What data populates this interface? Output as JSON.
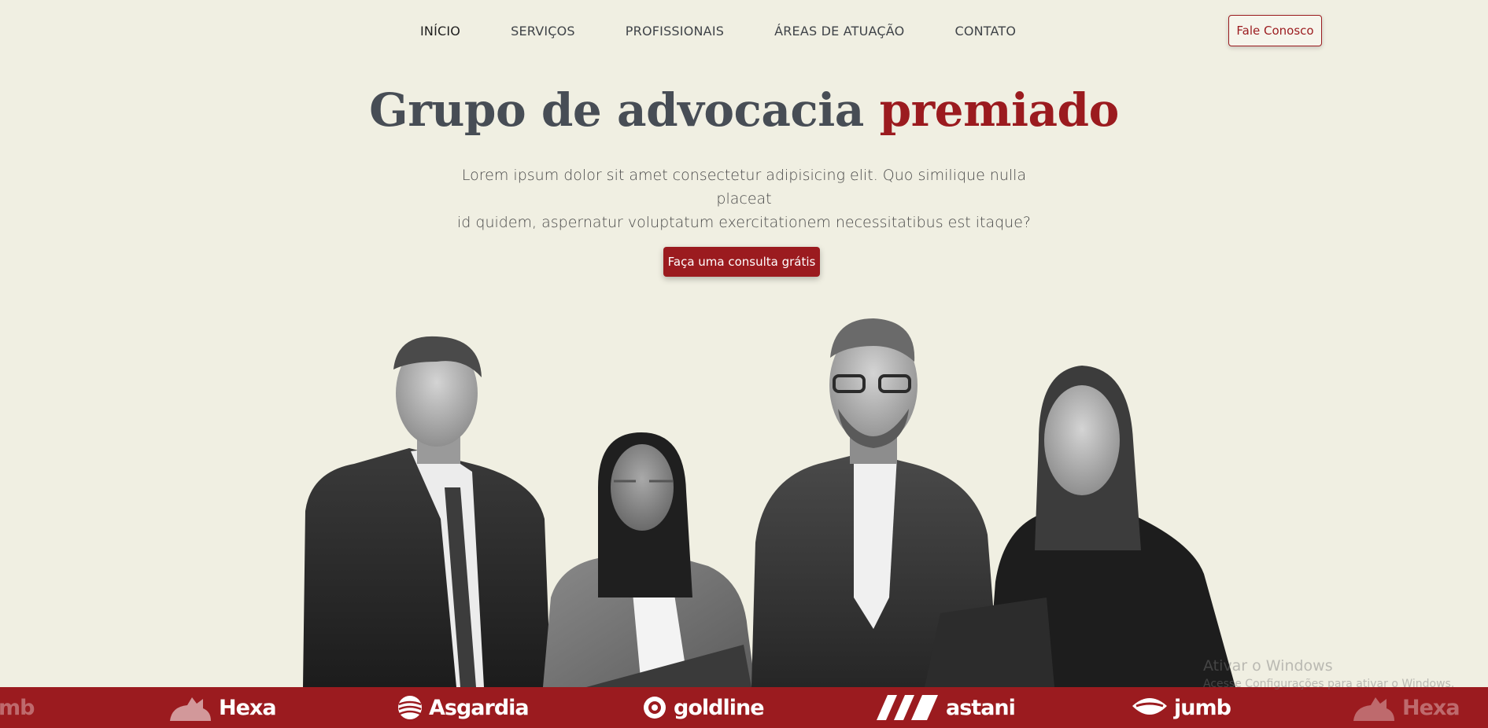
{
  "nav": {
    "links": [
      {
        "label": "INÍCIO"
      },
      {
        "label": "SERVIÇOS"
      },
      {
        "label": "PROFISSIONAIS"
      },
      {
        "label": "ÁREAS DE ATUAÇÃO"
      },
      {
        "label": "CONTATO"
      }
    ],
    "contact_button": "Fale Conosco"
  },
  "hero": {
    "title_part1": "Grupo de advocacia ",
    "title_accent": "premiado",
    "subtitle_line1": "Lorem ipsum dolor sit amet consectetur adipisicing elit. Quo similique nulla placeat",
    "subtitle_line2": "id quidem, aspernatur voluptatum exercitationem necessitatibus est itaque?",
    "cta": "Faça uma consulta grátis"
  },
  "logos": [
    {
      "name": "mb",
      "icon": "partial-logo-icon"
    },
    {
      "name": "Hexa",
      "icon": "cat-icon"
    },
    {
      "name": "Asgardia",
      "icon": "globe-icon"
    },
    {
      "name": "goldline",
      "icon": "ring-icon"
    },
    {
      "name": "astani",
      "icon": "slashes-icon"
    },
    {
      "name": "jumb",
      "icon": "eye-icon"
    },
    {
      "name": "Hexa",
      "icon": "cat-icon"
    }
  ],
  "watermark": {
    "line1": "Ativar o Windows",
    "line2": "Acesse Configurações para ativar o Windows."
  },
  "colors": {
    "background": "#f0efe2",
    "accent": "#9b1b1f",
    "text": "#474d55"
  }
}
